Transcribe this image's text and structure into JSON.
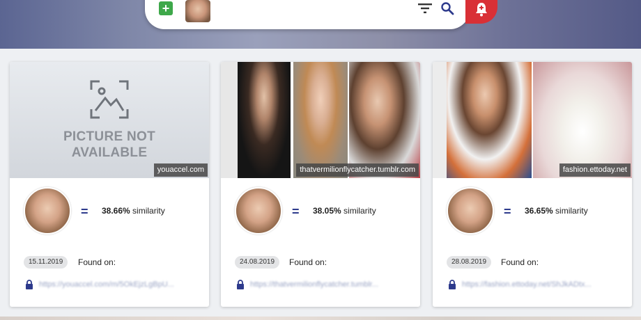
{
  "search_bar": {
    "add_icon": "plus-square-icon",
    "filter_icon": "filter-icon",
    "search_icon": "search-icon",
    "alert_icon": "bell-alert-icon"
  },
  "colors": {
    "accent": "#2d3a8c",
    "alert": "#d93036",
    "add": "#3ea84a"
  },
  "results": [
    {
      "image_unavailable": true,
      "placeholder_line1": "PICTURE NOT",
      "placeholder_line2": "AVAILABLE",
      "source": "youaccel.com",
      "similarity_value": "38.66%",
      "similarity_label": " similarity",
      "date": "15.11.2019",
      "found_on": "Found on:",
      "link": "https://youaccel.com/m/5OkEjzLgBpU..."
    },
    {
      "image_unavailable": false,
      "source": "thatvermilionflycatcher.tumblr.com",
      "similarity_value": "38.05%",
      "similarity_label": " similarity",
      "date": "24.08.2019",
      "found_on": "Found on:",
      "link": "https://thatvermilionflycatcher.tumblr..."
    },
    {
      "image_unavailable": false,
      "source": "fashion.ettoday.net",
      "similarity_value": "36.65%",
      "similarity_label": " similarity",
      "date": "28.08.2019",
      "found_on": "Found on:",
      "link": "https://fashion.ettoday.net/ShJkADtx..."
    }
  ]
}
